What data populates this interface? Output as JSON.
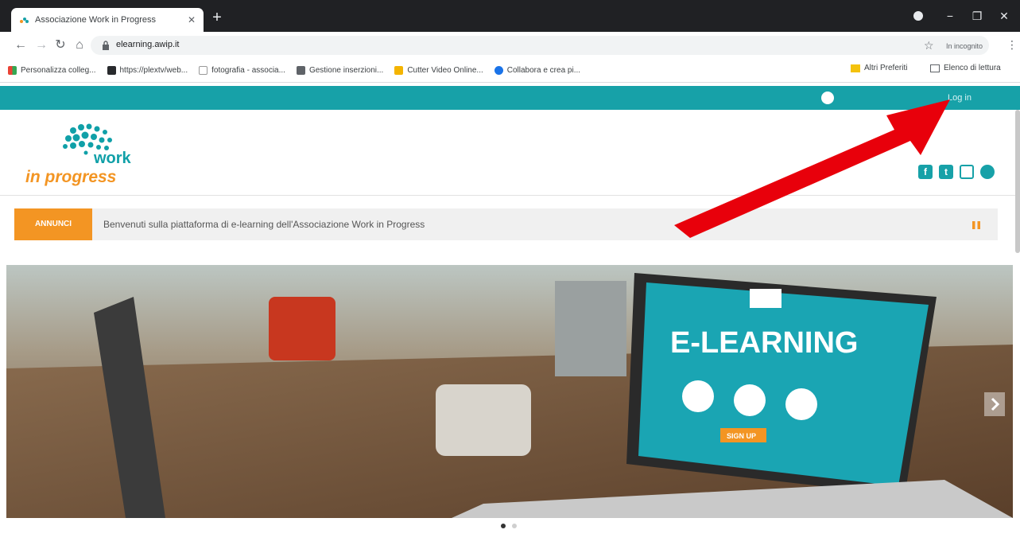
{
  "browser": {
    "tab_title": "Associazione Work in Progress",
    "url": "elearning.awip.it",
    "incognito_label": "In incognito",
    "bookmarks": [
      {
        "label": "Personalizza colleg...",
        "icon": "apps-grid-icon"
      },
      {
        "label": "https://plextv/web...",
        "icon": "plex-icon"
      },
      {
        "label": "fotografia - associa...",
        "icon": "i-icon"
      },
      {
        "label": "Gestione inserzioni...",
        "icon": "page-icon"
      },
      {
        "label": "Cutter Video Online...",
        "icon": "cutter-icon"
      },
      {
        "label": "Collabora e crea pi...",
        "icon": "globe-icon"
      }
    ],
    "other_bookmarks": "Altri Preferiti",
    "reading_list": "Elenco di lettura"
  },
  "site": {
    "login_label": "Log in",
    "logo_word1": "work",
    "logo_word2": "in progress",
    "announce_badge": "ANNUNCI",
    "announce_text": "Benvenuti sulla piattaforma di e-learning dell'Associazione Work in Progress",
    "slide_text": "E-LEARNING",
    "slide_button": "SIGN UP"
  },
  "colors": {
    "teal": "#17a1a8",
    "orange": "#f39523",
    "arrow": "#e8000b"
  }
}
